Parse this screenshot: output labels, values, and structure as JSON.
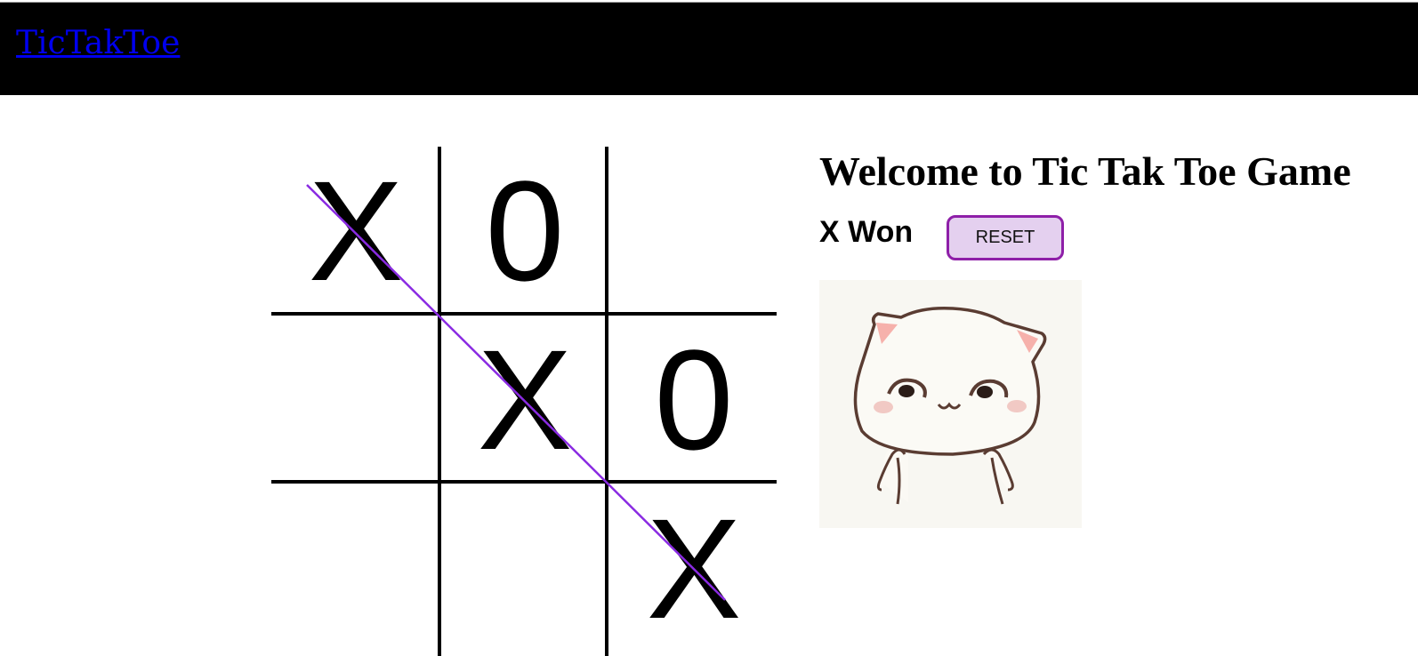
{
  "navbar": {
    "brand": "TicTakToe"
  },
  "game": {
    "board": [
      "X",
      "0",
      "",
      "",
      "X",
      "0",
      "",
      "",
      "X"
    ],
    "winning_cells": [
      0,
      4,
      8
    ],
    "win_line_color": "#8a2be2"
  },
  "side": {
    "title": "Welcome to Tic Tak Toe Game",
    "status": "X Won",
    "reset_label": "RESET",
    "reset_colors": {
      "border": "#8e1fa8",
      "fill": "#e4d0ef"
    },
    "image": "happy-cat-sticker"
  }
}
